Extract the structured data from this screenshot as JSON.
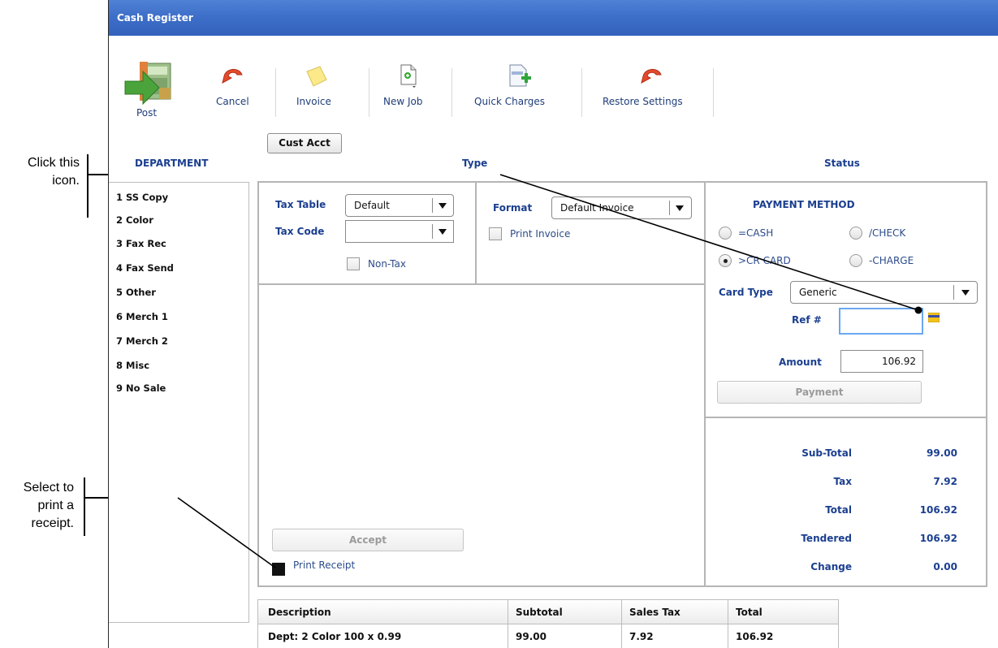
{
  "annotations": {
    "click_icon": [
      "Click this",
      "icon."
    ],
    "print_receipt": [
      "Select to",
      "print a",
      "receipt."
    ]
  },
  "window": {
    "title": "Cash Register"
  },
  "toolbar": {
    "post": "Post",
    "cancel": "Cancel",
    "invoice": "Invoice",
    "new_job": "New Job",
    "quick_charges": "Quick Charges",
    "restore_settings": "Restore Settings",
    "cust_acct": "Cust Acct"
  },
  "headers": {
    "department": "DEPARTMENT",
    "type": "Type",
    "status": "Status"
  },
  "departments": [
    "1 SS Copy",
    "2 Color",
    "3 Fax Rec",
    "4 Fax Send",
    "5 Other",
    "6 Merch 1",
    "7 Merch 2",
    "8 Misc",
    "9 No Sale"
  ],
  "tax": {
    "tax_table_label": "Tax Table",
    "tax_table_value": "Default",
    "tax_code_label": "Tax Code",
    "tax_code_value": "",
    "non_tax_label": "Non-Tax"
  },
  "format": {
    "label": "Format",
    "value": "Default Invoice",
    "print_invoice_label": "Print Invoice"
  },
  "actions": {
    "accept": "Accept",
    "print_receipt": "Print Receipt"
  },
  "payment": {
    "title": "PAYMENT METHOD",
    "options": [
      "=CASH",
      "/CHECK",
      ">CR CARD",
      "-CHARGE"
    ],
    "selected": ">CR CARD",
    "card_type_label": "Card Type",
    "card_type_value": "Generic",
    "ref_label": "Ref #",
    "ref_value": "",
    "amount_label": "Amount",
    "amount_value": "106.92",
    "payment_button": "Payment"
  },
  "totals": [
    {
      "label": "Sub-Total",
      "value": "99.00"
    },
    {
      "label": "Tax",
      "value": "7.92"
    },
    {
      "label": "Total",
      "value": "106.92"
    },
    {
      "label": "Tendered",
      "value": "106.92"
    },
    {
      "label": "Change",
      "value": "0.00"
    }
  ],
  "grid": {
    "columns": [
      "Description",
      "Subtotal",
      "Sales Tax",
      "Total"
    ],
    "rows": [
      [
        "Dept: 2 Color 100 x 0.99",
        "99.00",
        "7.92",
        "106.92"
      ]
    ]
  },
  "colors": {
    "title_bar": "#3b6cc6",
    "label_blue": "#1b3f8f",
    "focus_border": "#6aa8f0"
  }
}
